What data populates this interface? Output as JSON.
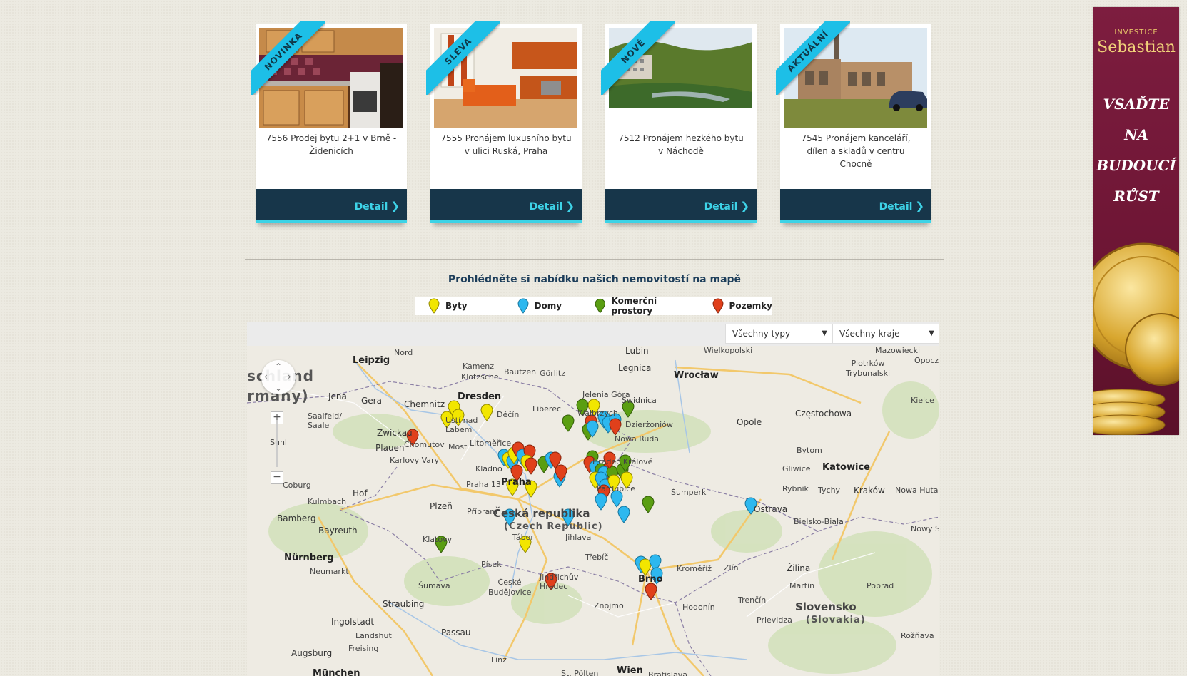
{
  "cards": [
    {
      "ribbon": "NOVINKA",
      "title": "7556 Prodej bytu 2+1 v Brně - Židenicích",
      "button": "Detail"
    },
    {
      "ribbon": "SLEVA",
      "title": "7555 Pronájem luxusního bytu v ulici Ruská, Praha",
      "button": "Detail"
    },
    {
      "ribbon": "NOVÉ",
      "title": "7512 Pronájem hezkého bytu v Náchodě",
      "button": "Detail"
    },
    {
      "ribbon": "AKTUÁLNÍ",
      "title": "7545 Pronájem kanceláří, dílen a skladů v centru Chocně",
      "button": "Detail"
    }
  ],
  "map_section": {
    "heading": "Prohlédněte si nabídku našich nemovitostí na mapě",
    "legend": [
      {
        "label": "Byty",
        "color": "#f2e600"
      },
      {
        "label": "Domy",
        "color": "#2db8ef"
      },
      {
        "label": "Komerční prostory",
        "color": "#5a9e12"
      },
      {
        "label": "Pozemky",
        "color": "#e0401b"
      }
    ],
    "filter_type": "Všechny typy",
    "filter_region": "Všechny kraje"
  },
  "map": {
    "countries": [
      "Česká republika",
      "(Czech Republic)",
      "Slovensko",
      "(Slovakia)"
    ],
    "partial_labels": [
      "schland",
      "rmany)"
    ],
    "cities": [
      "Leipzig",
      "Nord",
      "Bautzen",
      "Görlitz",
      "Legnica",
      "Lubin",
      "Wrocław",
      "Kamenz",
      "Klotzsche",
      "Dresden",
      "Chemnitz",
      "Jena",
      "Gera",
      "Zwickau",
      "Plauen",
      "Saalfeld/ Saale",
      "Suhl",
      "Coburg",
      "Kulmbach",
      "Hof",
      "Bamberg",
      "Bayreuth",
      "Nürnberg",
      "Neumarkt",
      "Ingolstadt",
      "Landshut",
      "Straubing",
      "Passau",
      "Augsburg",
      "Freising",
      "München",
      "Děčín",
      "Liberec",
      "Jelenia Góra",
      "Wałbrzych",
      "Świdnica",
      "Dzierżoniów",
      "Nowa Ruda",
      "Ústí nad Labem",
      "Chomutov",
      "Most",
      "Litoměřice",
      "Karlovy Vary",
      "Kladno",
      "Praha",
      "Praha 13",
      "Příbram",
      "Plzeň",
      "Klatovy",
      "Písek",
      "Tábor",
      "České Budějovice",
      "Jindřichův Hradec",
      "Šumava",
      "Jihlava",
      "Třebíč",
      "Znojmo",
      "Brno",
      "Kroměříž",
      "Zlín",
      "Hodonín",
      "Šumperk",
      "Ostrava",
      "Hradec Králové",
      "Pardubice",
      "Opole",
      "Częstochowa",
      "Kielce",
      "Piotrków Trybunalski",
      "Wielkopolski",
      "Mazowiecki",
      "Opoczno",
      "Bytom",
      "Gliwice",
      "Katowice",
      "Rybnik",
      "Tychy",
      "Kraków",
      "Nowa Huta",
      "Bielsko-Biała",
      "Nowy S",
      "Žilina",
      "Martin",
      "Poprad",
      "Trenčín",
      "Prievidza",
      "Rožňava",
      "Linz",
      "St. Pölten",
      "Wien",
      "Bratislava"
    ]
  },
  "ad": {
    "top": "INVESTICE",
    "brand": "Sebastian",
    "lines": [
      "VSAĎTE",
      "NA",
      "BUDOUCÍ",
      "RŮST"
    ]
  }
}
